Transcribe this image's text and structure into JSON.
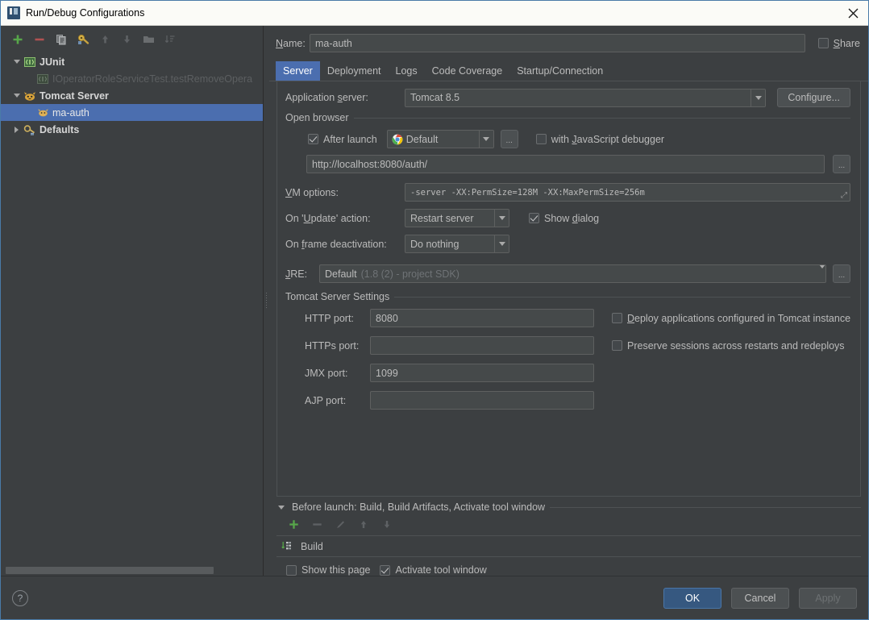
{
  "window": {
    "title": "Run/Debug Configurations",
    "app_icon": "intellij-idea-icon",
    "close_icon": "close-icon"
  },
  "tree_toolbar": {
    "buttons": [
      {
        "name": "add-configuration-button",
        "icon": "plus-icon",
        "enabled": true
      },
      {
        "name": "remove-configuration-button",
        "icon": "minus-icon",
        "enabled": true
      },
      {
        "name": "copy-configuration-button",
        "icon": "copy-icon",
        "enabled": true
      },
      {
        "name": "edit-defaults-button",
        "icon": "wrench-icon",
        "enabled": true
      },
      {
        "name": "move-up-button",
        "icon": "arrow-up-icon",
        "enabled": false
      },
      {
        "name": "move-down-button",
        "icon": "arrow-down-icon",
        "enabled": false
      },
      {
        "name": "new-folder-button",
        "icon": "folder-icon",
        "enabled": false
      },
      {
        "name": "sort-configurations-button",
        "icon": "sort-icon",
        "enabled": false
      }
    ]
  },
  "tree": {
    "nodes": [
      {
        "label": "JUnit",
        "icon": "junit-icon",
        "expanded": true,
        "level": 0,
        "style": "bold",
        "selected": false
      },
      {
        "label": "IOperatorRoleServiceTest.testRemoveOpera",
        "icon": "junit-test-icon",
        "expanded": null,
        "level": 1,
        "style": "dim",
        "selected": false
      },
      {
        "label": "Tomcat Server",
        "icon": "tomcat-icon",
        "expanded": true,
        "level": 0,
        "style": "bold",
        "selected": false
      },
      {
        "label": "ma-auth",
        "icon": "tomcat-config-icon",
        "expanded": null,
        "level": 1,
        "style": "normal",
        "selected": true
      },
      {
        "label": "Defaults",
        "icon": "defaults-icon",
        "expanded": false,
        "level": 0,
        "style": "bold",
        "selected": false
      }
    ]
  },
  "header": {
    "name_label": "Name:",
    "name_value": "ma-auth",
    "share_label": "Share",
    "share_checked": false
  },
  "tabs": [
    {
      "label": "Server",
      "active": true
    },
    {
      "label": "Deployment",
      "active": false
    },
    {
      "label": "Logs",
      "active": false
    },
    {
      "label": "Code Coverage",
      "active": false
    },
    {
      "label": "Startup/Connection",
      "active": false
    }
  ],
  "server_tab": {
    "application_server": {
      "label": "Application server:",
      "value": "Tomcat 8.5",
      "configure_button": "Configure..."
    },
    "open_browser": {
      "group_title": "Open browser",
      "after_launch_label": "After launch",
      "after_launch_checked": true,
      "browser_value": "Default",
      "browser_icon": "chrome-icon",
      "browse_button": "...",
      "js_debugger_label": "with JavaScript debugger",
      "js_debugger_checked": false,
      "url_value": "http://localhost:8080/auth/",
      "url_browse_button": "..."
    },
    "vm_options": {
      "label": "VM options:",
      "value": "-server -XX:PermSize=128M -XX:MaxPermSize=256m",
      "expand_glyph": "expand-editor-icon"
    },
    "on_update_action": {
      "label": "On 'Update' action:",
      "value": "Restart server",
      "show_dialog_label": "Show dialog",
      "show_dialog_checked": true
    },
    "on_frame_deactivation": {
      "label": "On frame deactivation:",
      "value": "Do nothing"
    },
    "jre": {
      "label": "JRE:",
      "value": "Default",
      "hint": "(1.8 (2) - project SDK)",
      "browse_button": "..."
    },
    "tomcat_settings": {
      "group_title": "Tomcat Server Settings",
      "ports": [
        {
          "label": "HTTP port:",
          "value": "8080",
          "name": "http-port-input"
        },
        {
          "label": "HTTPs port:",
          "value": "",
          "name": "https-port-input"
        },
        {
          "label": "JMX port:",
          "value": "1099",
          "name": "jmx-port-input"
        },
        {
          "label": "AJP port:",
          "value": "",
          "name": "ajp-port-input"
        }
      ],
      "checkboxes": [
        {
          "label": "Deploy applications configured in Tomcat instance",
          "checked": false,
          "name": "deploy-applications-checkbox"
        },
        {
          "label": "Preserve sessions across restarts and redeploys",
          "checked": false,
          "name": "preserve-sessions-checkbox"
        }
      ]
    }
  },
  "before_launch": {
    "title": "Before launch: Build, Build Artifacts, Activate tool window",
    "expanded": true,
    "toolbar": [
      {
        "name": "add-task-button",
        "icon": "plus-icon",
        "enabled": true
      },
      {
        "name": "remove-task-button",
        "icon": "minus-icon",
        "enabled": false
      },
      {
        "name": "edit-task-button",
        "icon": "pencil-icon",
        "enabled": false
      },
      {
        "name": "task-move-up-button",
        "icon": "arrow-up-icon",
        "enabled": false
      },
      {
        "name": "task-move-down-button",
        "icon": "arrow-down-icon",
        "enabled": false
      }
    ],
    "tasks": [
      {
        "label": "Build",
        "icon": "build-icon"
      }
    ],
    "show_this_page_label": "Show this page",
    "show_this_page_checked": false,
    "activate_tool_window_label": "Activate tool window",
    "activate_tool_window_checked": true
  },
  "footer": {
    "help_label": "?",
    "ok_label": "OK",
    "cancel_label": "Cancel",
    "apply_label": "Apply",
    "apply_enabled": false
  },
  "colors": {
    "accent": "#4b6eaf",
    "primary_button": "#365880",
    "panel_bg": "#3c3f41",
    "field_bg": "#45494a",
    "text": "#bbbbbb",
    "titlebar_bg": "#fbfbf7"
  }
}
